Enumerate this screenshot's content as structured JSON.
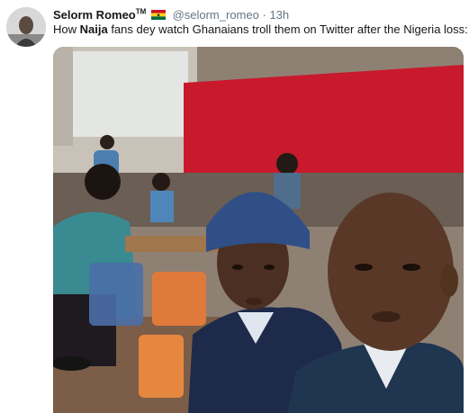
{
  "tweet": {
    "author": {
      "display_name": "Selorm Romeo",
      "trademark": "TM",
      "flag_icon": "ghana-flag-icon",
      "handle": "@selorm_romeo",
      "separator": "·",
      "timestamp": "13h"
    },
    "text": {
      "before": "How ",
      "bold": "Naija",
      "after": " fans dey watch Ghanaians troll them on Twitter after the Nigeria loss:"
    },
    "media": {
      "icon": "photo-icon"
    }
  },
  "colors": {
    "name": "#14171a",
    "meta": "#657786",
    "flag_red": "#ce1126",
    "flag_gold": "#fcd116",
    "flag_green": "#006b3f"
  }
}
